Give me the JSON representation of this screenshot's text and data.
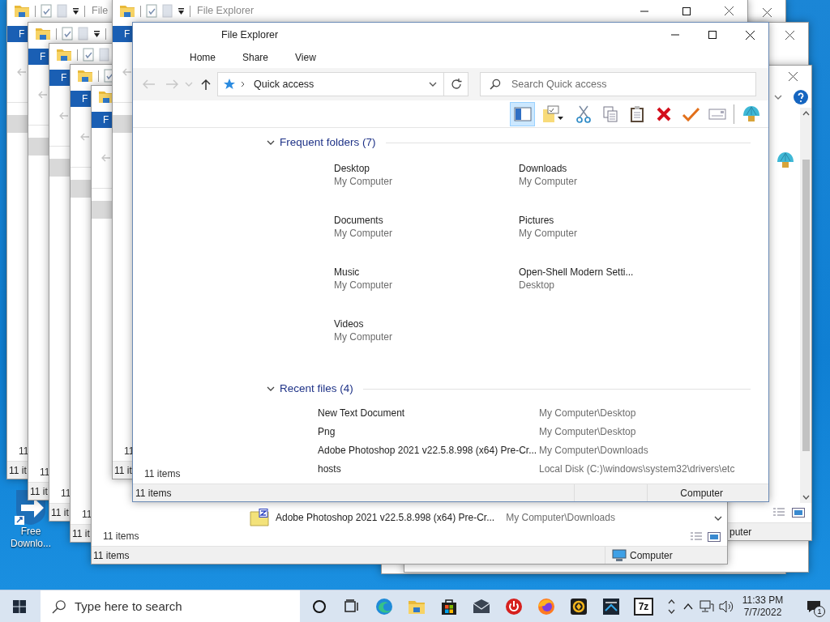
{
  "desktop_icons": [
    {
      "label": "Free Downlo..."
    }
  ],
  "back_windows": [
    {
      "title": "File",
      "file_tab": "F",
      "pane_count": "11",
      "status": "11 it"
    },
    {
      "file_tab": "F",
      "pane_count": "11",
      "status": "11 it"
    },
    {
      "file_tab": "F",
      "pane_count": "11",
      "status": "11 it"
    },
    {
      "file_tab": "F",
      "pane_count": "11",
      "status": "11 it"
    },
    {
      "file_tab": "F",
      "recent_row": {
        "name": "Adobe Photoshop 2021 v22.5.8.998 (x64) Pre-Cr...",
        "location": "My Computer\\Downloads"
      },
      "pane_count": "11 items",
      "status": "11 items",
      "status_location": "Computer"
    },
    {
      "title": "File Explorer",
      "file_tab": "F",
      "pane_count": "11",
      "status": "11 it"
    }
  ],
  "right_window": {
    "status": "puter"
  },
  "window": {
    "title": "File Explorer",
    "ribbon_tabs": [
      "Home",
      "Share",
      "View"
    ],
    "address": "Quick access",
    "search": {
      "placeholder": "Search Quick access"
    },
    "toolbar": [
      {
        "kind": "pane",
        "on": true
      },
      {
        "kind": "properties",
        "on": false
      },
      {
        "kind": "cut",
        "on": false
      },
      {
        "kind": "copy",
        "on": false
      },
      {
        "kind": "paste",
        "on": false
      },
      {
        "kind": "delete",
        "on": false
      },
      {
        "kind": "check",
        "on": false
      },
      {
        "kind": "card",
        "on": false
      },
      {
        "kind": "shell",
        "on": false
      }
    ],
    "groups": [
      {
        "title": "Frequent folders (7)",
        "expanded": true,
        "kind": "tiles",
        "items": [
          {
            "name": "Desktop",
            "location": "My Computer"
          },
          {
            "name": "Downloads",
            "location": "My Computer"
          },
          {
            "name": "Documents",
            "location": "My Computer"
          },
          {
            "name": "Pictures",
            "location": "My Computer"
          },
          {
            "name": "Music",
            "location": "My Computer"
          },
          {
            "name": "Open-Shell Modern Setti...",
            "location": "Desktop"
          },
          {
            "name": "Videos",
            "location": "My Computer"
          }
        ]
      },
      {
        "title": "Recent files (4)",
        "expanded": true,
        "kind": "rows",
        "items": [
          {
            "name": "New Text Document",
            "location": "My Computer\\Desktop"
          },
          {
            "name": "Png",
            "location": "My Computer\\Desktop"
          },
          {
            "name": "Adobe Photoshop 2021 v22.5.8.998 (x64) Pre-Cr...",
            "location": "My Computer\\Downloads"
          },
          {
            "name": "hosts",
            "location": "Local Disk (C:)\\windows\\system32\\drivers\\etc"
          }
        ]
      }
    ],
    "pane_count": "11 items",
    "status": "11 items",
    "status_location": "Computer"
  },
  "taskbar": {
    "search_placeholder": "Type here to search",
    "apps": [
      {
        "kind": "cortana"
      },
      {
        "kind": "taskview"
      },
      {
        "kind": "edge"
      },
      {
        "kind": "explorer"
      },
      {
        "kind": "store"
      },
      {
        "kind": "mail"
      },
      {
        "kind": "power"
      },
      {
        "kind": "firefox"
      },
      {
        "kind": "yellow"
      },
      {
        "kind": "dark"
      },
      {
        "kind": "archive",
        "label": "7z"
      }
    ],
    "time": "11:33 PM",
    "date": "7/7/2022",
    "notifications": "1"
  }
}
